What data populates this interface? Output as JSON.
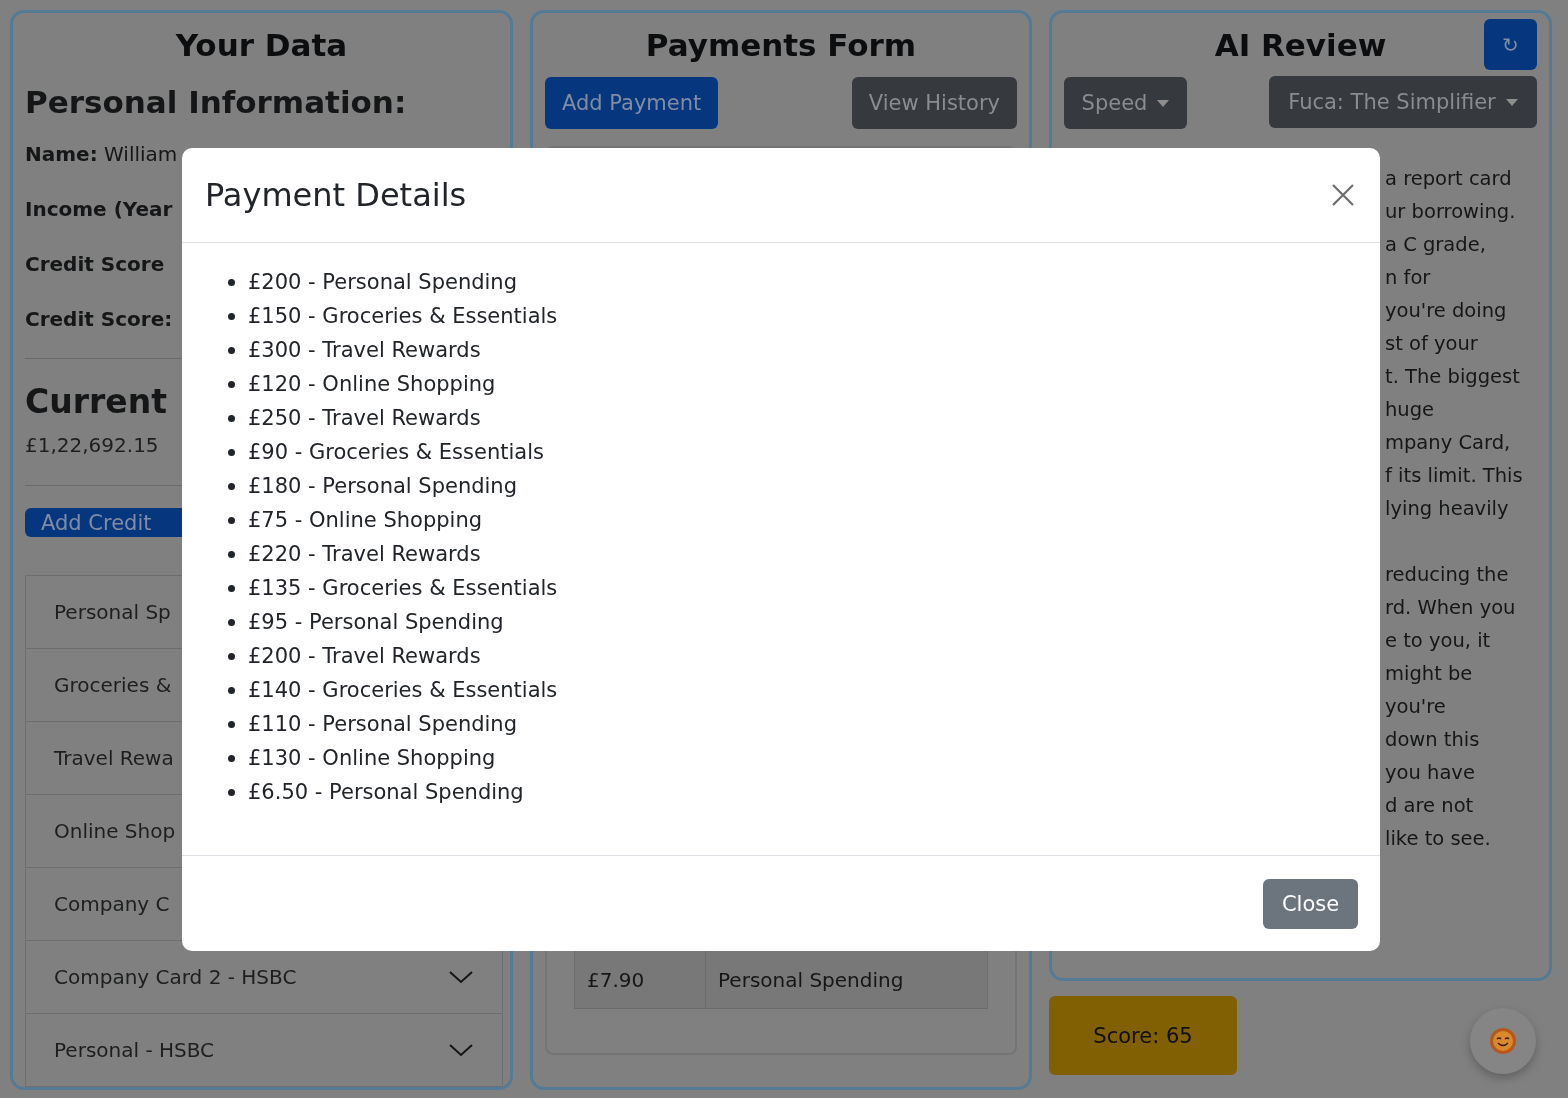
{
  "your_data": {
    "title": "Your Data",
    "heading": "Personal Information:",
    "fields": [
      {
        "label": "Name:",
        "value": "William"
      },
      {
        "label": "Income (Year"
      },
      {
        "label": "Credit Score"
      },
      {
        "label": "Credit Score:"
      }
    ],
    "balance_heading": "Current",
    "balance": "£1,22,692.15",
    "add_button": "Add Credit",
    "cards_behind_dialog": [
      "Personal Sp",
      "Groceries &",
      "Travel Rewa",
      "Online Shop",
      "Company C"
    ],
    "cards": [
      "Company Card 2 - HSBC",
      "Personal - HSBC"
    ]
  },
  "payments_form": {
    "title": "Payments Form",
    "buttons": [
      {
        "label": "Add Payment",
        "kind": "primary"
      },
      {
        "label": "View History",
        "kind": "secondary"
      }
    ],
    "table_row": [
      "£7.90",
      "Personal Spending"
    ]
  },
  "ai_review": {
    "title": "AI Review",
    "refresh": "↻",
    "dropdowns": [
      "Speed",
      "Fuca: The Simplifier"
    ],
    "paragraphs": [
      [
        "a report card",
        "ur borrowing.",
        "a C grade,",
        "n for",
        "you're doing",
        "st of your",
        "t. The biggest",
        "huge",
        "mpany Card,",
        "f its limit. This",
        "lying heavily"
      ],
      [
        "reducing the",
        "rd. When you",
        "e to you, it",
        "might be",
        "you're",
        "down this",
        "you have",
        "d are not",
        "like to see."
      ]
    ]
  },
  "score": "Score: 65",
  "modal": {
    "title": "Payment Details",
    "items": [
      "£200 - Personal Spending",
      "£150 - Groceries & Essentials",
      "£300 - Travel Rewards",
      "£120 - Online Shopping",
      "£250 - Travel Rewards",
      "£90 - Groceries & Essentials",
      "£180 - Personal Spending",
      "£75 - Online Shopping",
      "£220 - Travel Rewards",
      "£135 - Groceries & Essentials",
      "£95 - Personal Spending",
      "£200 - Travel Rewards",
      "£140 - Groceries & Essentials",
      "£110 - Personal Spending",
      "£130 - Online Shopping",
      "£6.50 - Personal Spending"
    ],
    "close_button": "Close"
  }
}
